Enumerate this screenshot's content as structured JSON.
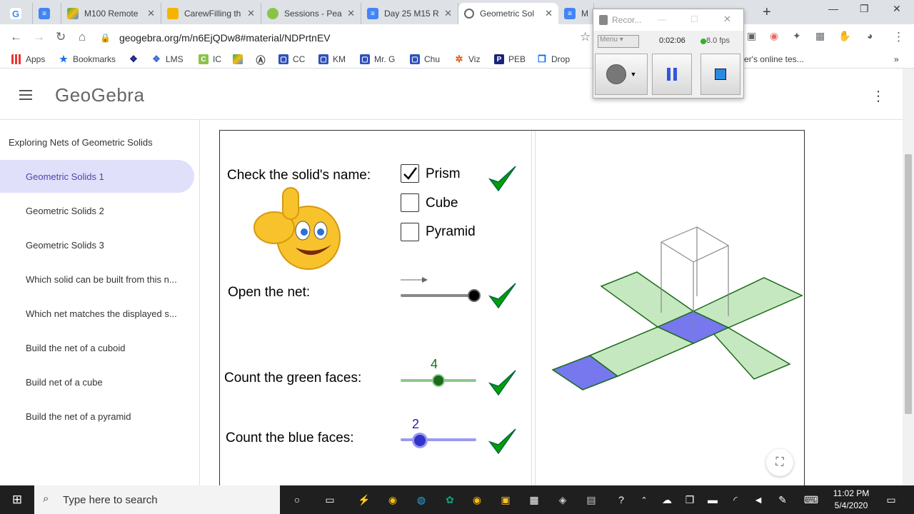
{
  "tabs": [
    {
      "label": "",
      "favicon": "google-g"
    },
    {
      "label": "",
      "favicon": "docs"
    },
    {
      "label": "M100 Remote",
      "favicon": "drive"
    },
    {
      "label": "CarewFilling th",
      "favicon": "slides"
    },
    {
      "label": "Sessions - Pea",
      "favicon": "pear"
    },
    {
      "label": "Day 25 M15 R",
      "favicon": "docs"
    },
    {
      "label": "Geometric Sol",
      "favicon": "geogebra"
    },
    {
      "label": "MC",
      "favicon": "docs"
    }
  ],
  "address": {
    "url": "geogebra.org/m/n6EjQDw8#material/NDPrtnEV"
  },
  "bookmarks": [
    {
      "label": "Apps"
    },
    {
      "label": "Bookmarks"
    },
    {
      "label": ""
    },
    {
      "label": "LMS"
    },
    {
      "label": "IC"
    },
    {
      "label": ""
    },
    {
      "label": ""
    },
    {
      "label": "CC"
    },
    {
      "label": "KM"
    },
    {
      "label": "Mr. G"
    },
    {
      "label": "Chu"
    },
    {
      "label": "Viz"
    },
    {
      "label": "PEB"
    },
    {
      "label": "Drop"
    },
    {
      "label": "er's online tes..."
    }
  ],
  "header": {
    "logo": "GeoGebra"
  },
  "sidebar": {
    "title": "Exploring Nets of Geometric Solids",
    "items": [
      {
        "label": "Geometric Solids 1"
      },
      {
        "label": "Geometric Solids 2"
      },
      {
        "label": "Geometric Solids 3"
      },
      {
        "label": "Which solid can be built from this n..."
      },
      {
        "label": "Which net matches the displayed s..."
      },
      {
        "label": "Build the net of a cuboid"
      },
      {
        "label": "Build net of a cube"
      },
      {
        "label": "Build the net of a pyramid"
      }
    ]
  },
  "applet": {
    "check_name_label": "Check the solid's name:",
    "options": [
      {
        "label": "Prism",
        "checked": true
      },
      {
        "label": "Cube",
        "checked": false
      },
      {
        "label": "Pyramid",
        "checked": false
      }
    ],
    "open_net_label": "Open the net:",
    "open_net_value": 1,
    "green_label": "Count the green faces:",
    "green_value": "4",
    "blue_label": "Count the blue faces:",
    "blue_value": "2",
    "colors": {
      "green_face": "#c6e8c0",
      "green_edge": "#1b6b1b",
      "blue_face": "#7777ee",
      "blue_slider": "#3333cc",
      "check": "#00a000"
    }
  },
  "recorder": {
    "title": "Recor...",
    "menu": "Menu",
    "time": "0:02:06",
    "fps": "8.0 fps"
  },
  "taskbar": {
    "search_placeholder": "Type here to search",
    "time": "11:02 PM",
    "date": "5/4/2020"
  }
}
